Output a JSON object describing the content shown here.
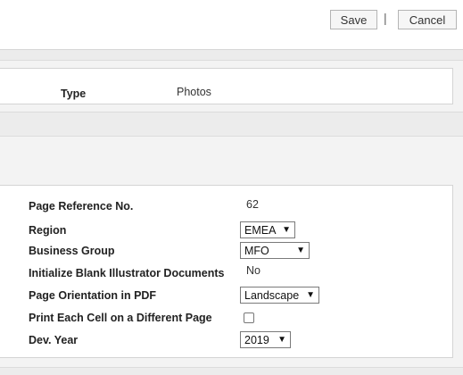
{
  "toolbar": {
    "save_label": "Save",
    "separator": "|",
    "cancel_label": "Cancel"
  },
  "summary": {
    "type_label": "Type",
    "type_value": "Photos"
  },
  "form": {
    "page_ref_label": "Page Reference No.",
    "page_ref_value": "62",
    "region_label": "Region",
    "region_value": "EMEA",
    "business_group_label": "Business Group",
    "business_group_value": "MFO",
    "init_blank_label": "Initialize Blank Illustrator Documents",
    "init_blank_value": "No",
    "orientation_label": "Page Orientation in PDF",
    "orientation_value": "Landscape",
    "print_each_label": "Print Each Cell on a Different Page",
    "print_each_checked": false,
    "dev_year_label": "Dev. Year",
    "dev_year_value": "2019"
  },
  "icons": {
    "dropdown_arrow": "triangle-down-icon"
  }
}
